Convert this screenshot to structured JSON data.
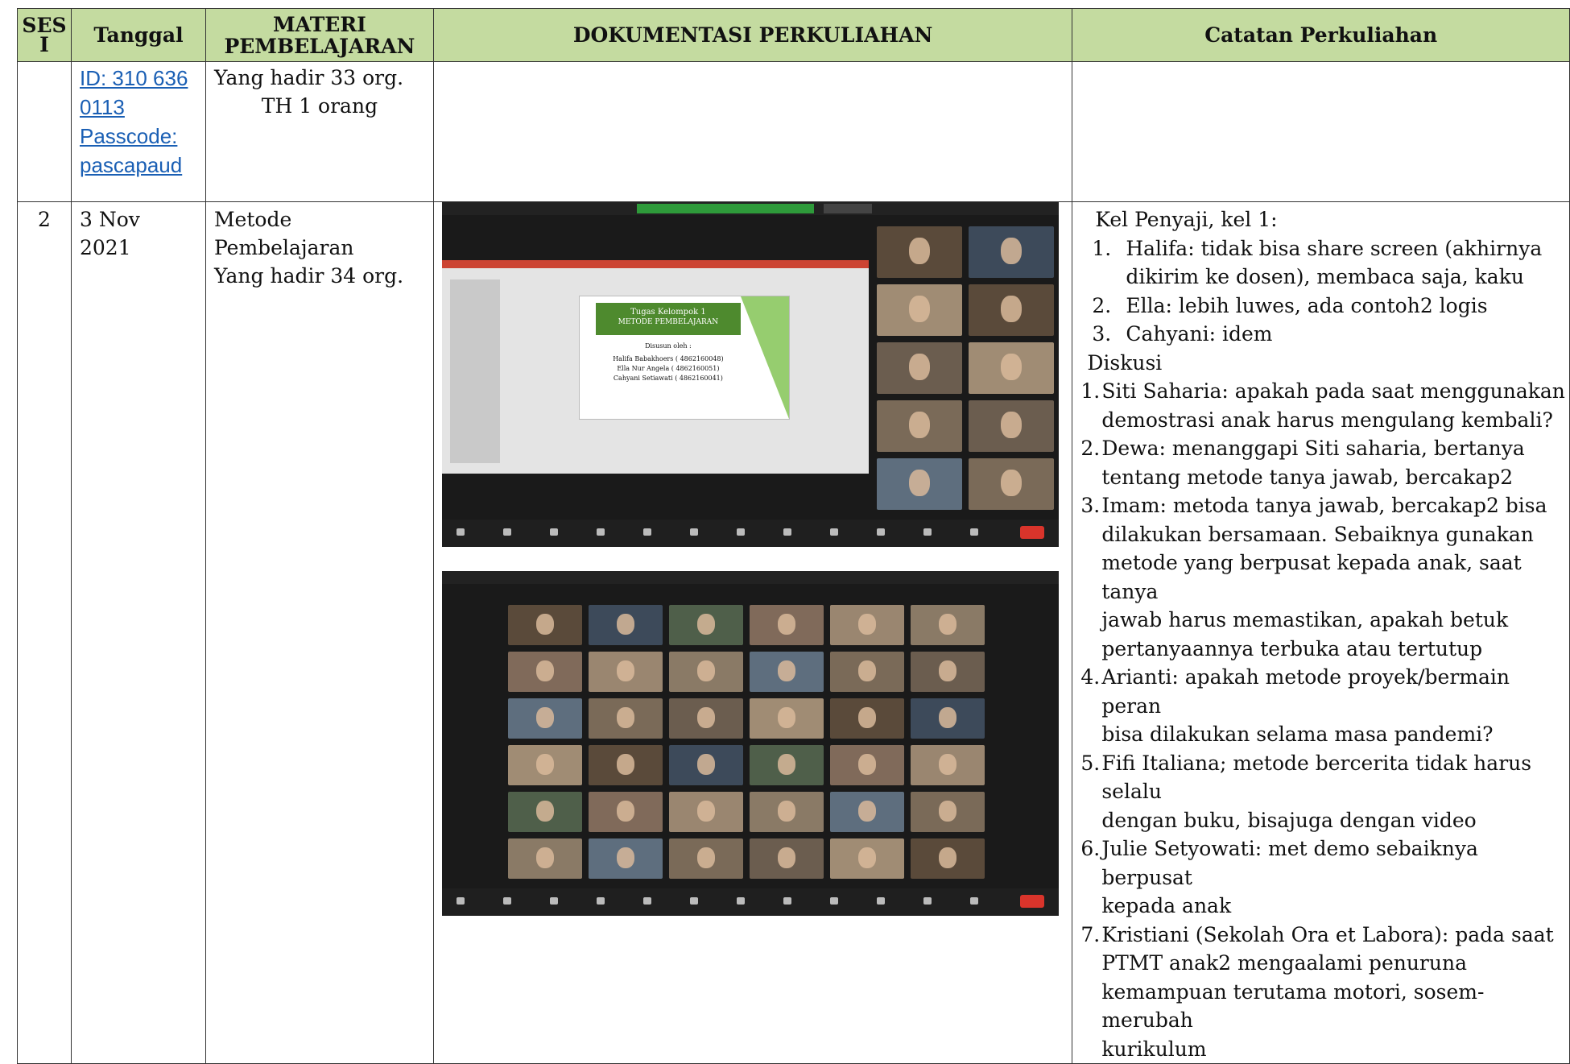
{
  "headers": {
    "sesi": "SES I",
    "tanggal": "Tanggal",
    "materi": "MATERI PEMBELAJARAN",
    "dokumentasi": "DOKUMENTASI PERKULIAHAN",
    "catatan": "Catatan Perkuliahan"
  },
  "row1": {
    "zoom_link_lines": [
      "ID: 310 636",
      "0113",
      "Passcode:",
      "pascapaud"
    ],
    "materi_lines": [
      "Yang hadir 33 org.",
      "TH 1 orang"
    ]
  },
  "row2": {
    "sesi": "2",
    "tanggal": "3 Nov 2021",
    "materi_lines": [
      "Metode",
      "Pembelajaran",
      "Yang hadir 34 org."
    ],
    "screenshot1": {
      "slide_title": "Tugas Kelompok 1",
      "slide_subtitle": "METODE PEMBELAJARAN",
      "slide_by": "Disusun oleh :",
      "slide_names": [
        "Halifa Babakhoers ( 4862160048)",
        "Ella Nur Angela ( 4862160051)",
        "Cahyani Setiawati ( 4862160041)"
      ]
    },
    "notes": {
      "intro": "Kel Penyaji, kel 1:",
      "presenters": [
        {
          "n": "1.",
          "text": "Halifa: tidak bisa share screen (akhirnya",
          "cont": "dikirim ke dosen), membaca saja, kaku"
        },
        {
          "n": "2.",
          "text": "Ella: lebih luwes, ada contoh2 logis",
          "cont": ""
        },
        {
          "n": "3.",
          "text": "Cahyani: idem",
          "cont": ""
        }
      ],
      "diskusi_label": "Diskusi",
      "discussion": [
        {
          "n": "1.",
          "lines": [
            "Siti Saharia: apakah pada saat menggunakan",
            "demostrasi anak harus mengulang kembali?"
          ]
        },
        {
          "n": "2.",
          "lines": [
            "Dewa: menanggapi Siti saharia, bertanya",
            "tentang metode tanya jawab, bercakap2"
          ]
        },
        {
          "n": "3.",
          "lines": [
            "Imam: metoda tanya jawab, bercakap2 bisa",
            "dilakukan bersamaan. Sebaiknya gunakan",
            "metode yang berpusat kepada anak, saat tanya",
            "jawab harus memastikan, apakah betuk",
            "pertanyaannya terbuka atau tertutup"
          ]
        },
        {
          "n": "4.",
          "lines": [
            "Arianti: apakah metode proyek/bermain peran",
            "bisa dilakukan selama masa pandemi?"
          ]
        },
        {
          "n": "5.",
          "lines": [
            "Fifi Italiana; metode bercerita tidak harus selalu",
            "dengan buku, bisajuga dengan video"
          ]
        },
        {
          "n": "6.",
          "lines": [
            "Julie Setyowati: met demo sebaiknya berpusat",
            "kepada anak"
          ]
        },
        {
          "n": "7.",
          "lines": [
            "Kristiani (Sekolah Ora et Labora): pada saat",
            "PTMT anak2 mengaalami penuruna",
            "kemampuan terutama motori, sosem- merubah",
            "kurikulum"
          ]
        }
      ]
    }
  },
  "colors": {
    "header_bg": "#c4dba0",
    "link": "#1a5fb4",
    "zoom_bg": "#1a1a1a",
    "slide_green": "#4e8a2e"
  }
}
